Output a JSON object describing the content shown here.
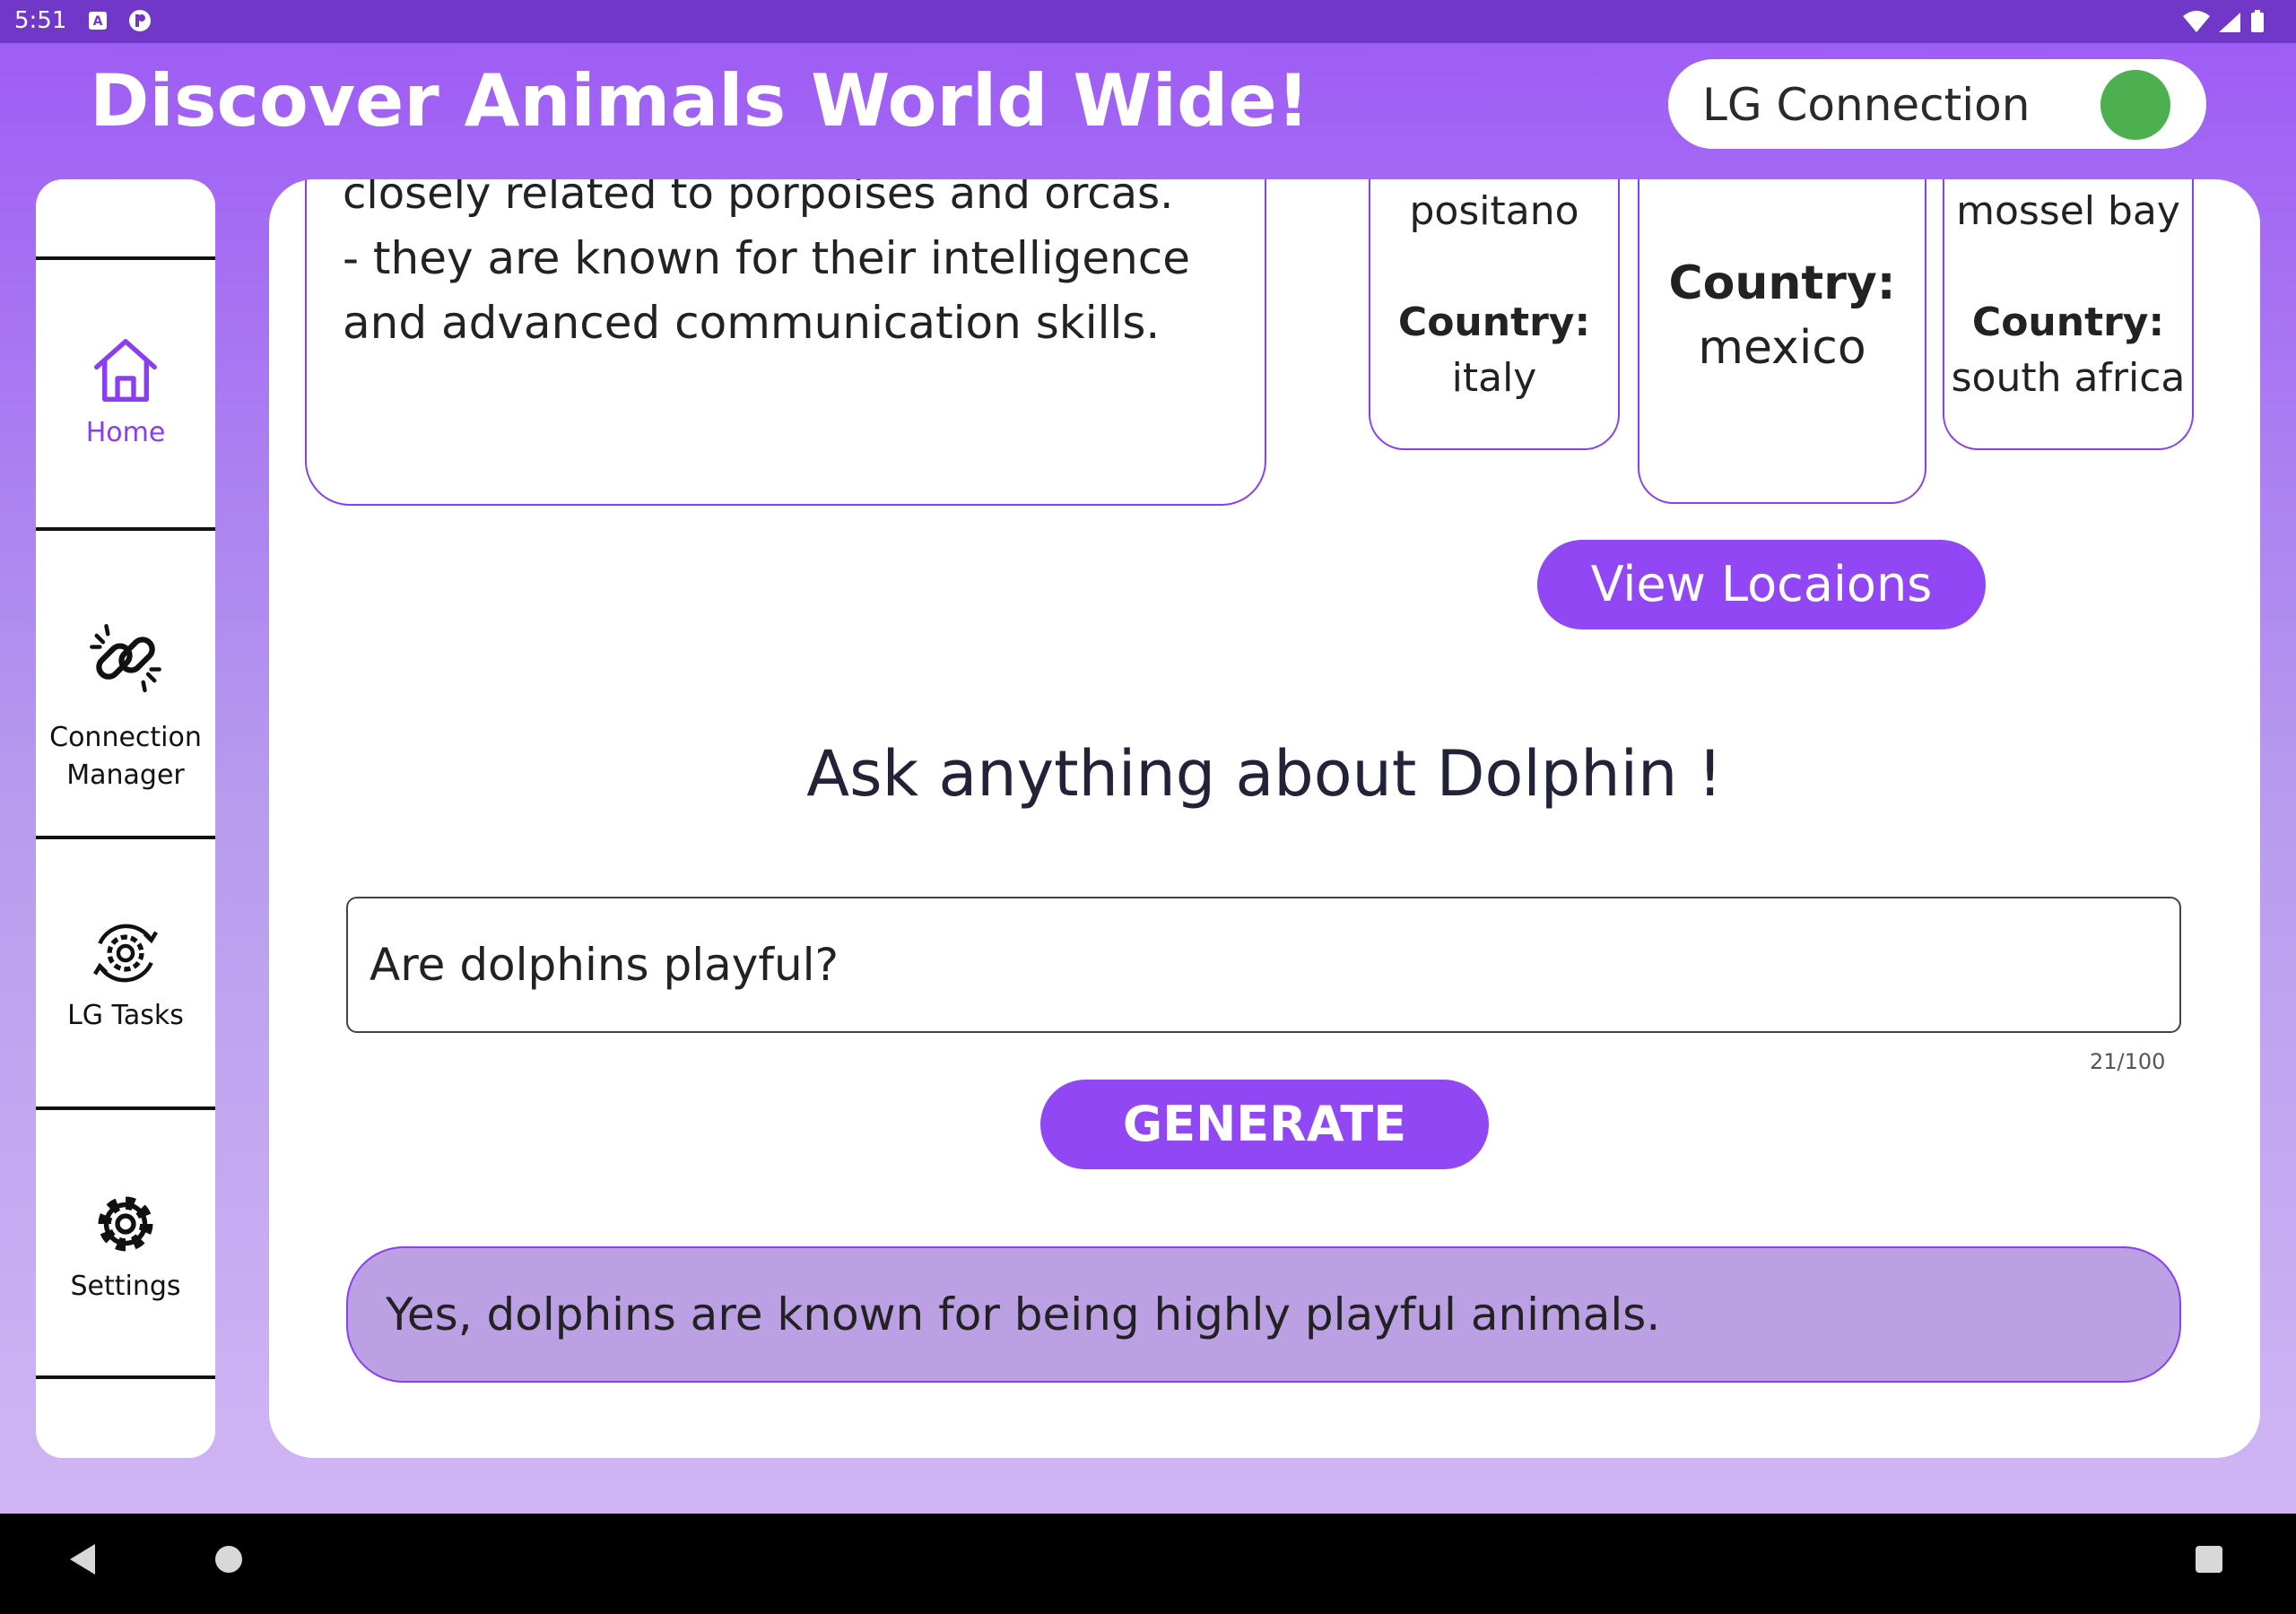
{
  "status_bar": {
    "time": "5:51",
    "icons": [
      "a-notification-icon",
      "p-notification-icon",
      "wifi-icon",
      "signal-icon",
      "battery-icon"
    ]
  },
  "header": {
    "title": "Discover Animals World Wide!",
    "lg_connection_label": "LG Connection",
    "lg_connection_status_color": "#4caf50"
  },
  "sidebar": {
    "items": [
      {
        "label": "Home",
        "icon": "home-icon",
        "active": true
      },
      {
        "label": "Connection\nManager",
        "icon": "link-icon",
        "active": false
      },
      {
        "label": "LG Tasks",
        "icon": "gear-sync-icon",
        "active": false
      },
      {
        "label": "Settings",
        "icon": "gear-icon",
        "active": false
      }
    ]
  },
  "info_card": {
    "clipped_line": "closely related to porpoises and orcas.",
    "bullet": "- they are known for their intelligence and advanced communication skills."
  },
  "locations": [
    {
      "city": "positano",
      "country_label": "Country:",
      "country": "italy"
    },
    {
      "city": "",
      "country_label": "Country:",
      "country": "mexico"
    },
    {
      "city": "mossel bay",
      "country_label": "Country:",
      "country": "south africa"
    }
  ],
  "view_locations_label": "View Locaions",
  "ask": {
    "title": "Ask anything about Dolphin !",
    "input_value": "Are dolphins playful?",
    "counter": "21/100",
    "generate_label": "GENERATE",
    "answer": "Yes, dolphins are known for being highly playful animals."
  },
  "colors": {
    "accent": "#9247f5",
    "status_bar": "#7137c8",
    "answer_bg": "#bba0e3"
  },
  "system_nav": [
    "back-icon",
    "home-circle-icon",
    "recents-icon"
  ]
}
